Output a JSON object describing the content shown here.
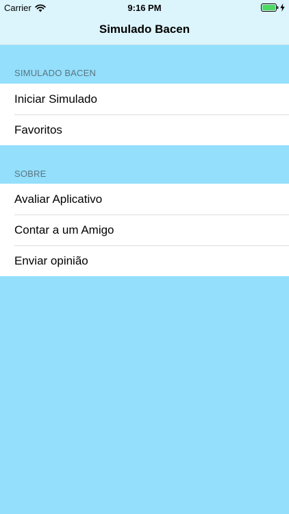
{
  "status_bar": {
    "carrier": "Carrier",
    "time": "9:16 PM",
    "icons": [
      "wifi-icon",
      "battery-icon",
      "charging-bolt-icon"
    ]
  },
  "nav": {
    "title": "Simulado Bacen"
  },
  "sections": [
    {
      "header": "SIMULADO BACEN",
      "items": [
        "Iniciar Simulado",
        "Favoritos"
      ]
    },
    {
      "header": "SOBRE",
      "items": [
        "Avaliar Aplicativo",
        "Contar a um Amigo",
        "Enviar opinião"
      ]
    }
  ],
  "colors": {
    "background": "#93dffc",
    "nav_background": "#dcf4fb",
    "cell_background": "#ffffff",
    "section_header_text": "#5b7580",
    "battery_fill": "#4cd964"
  }
}
